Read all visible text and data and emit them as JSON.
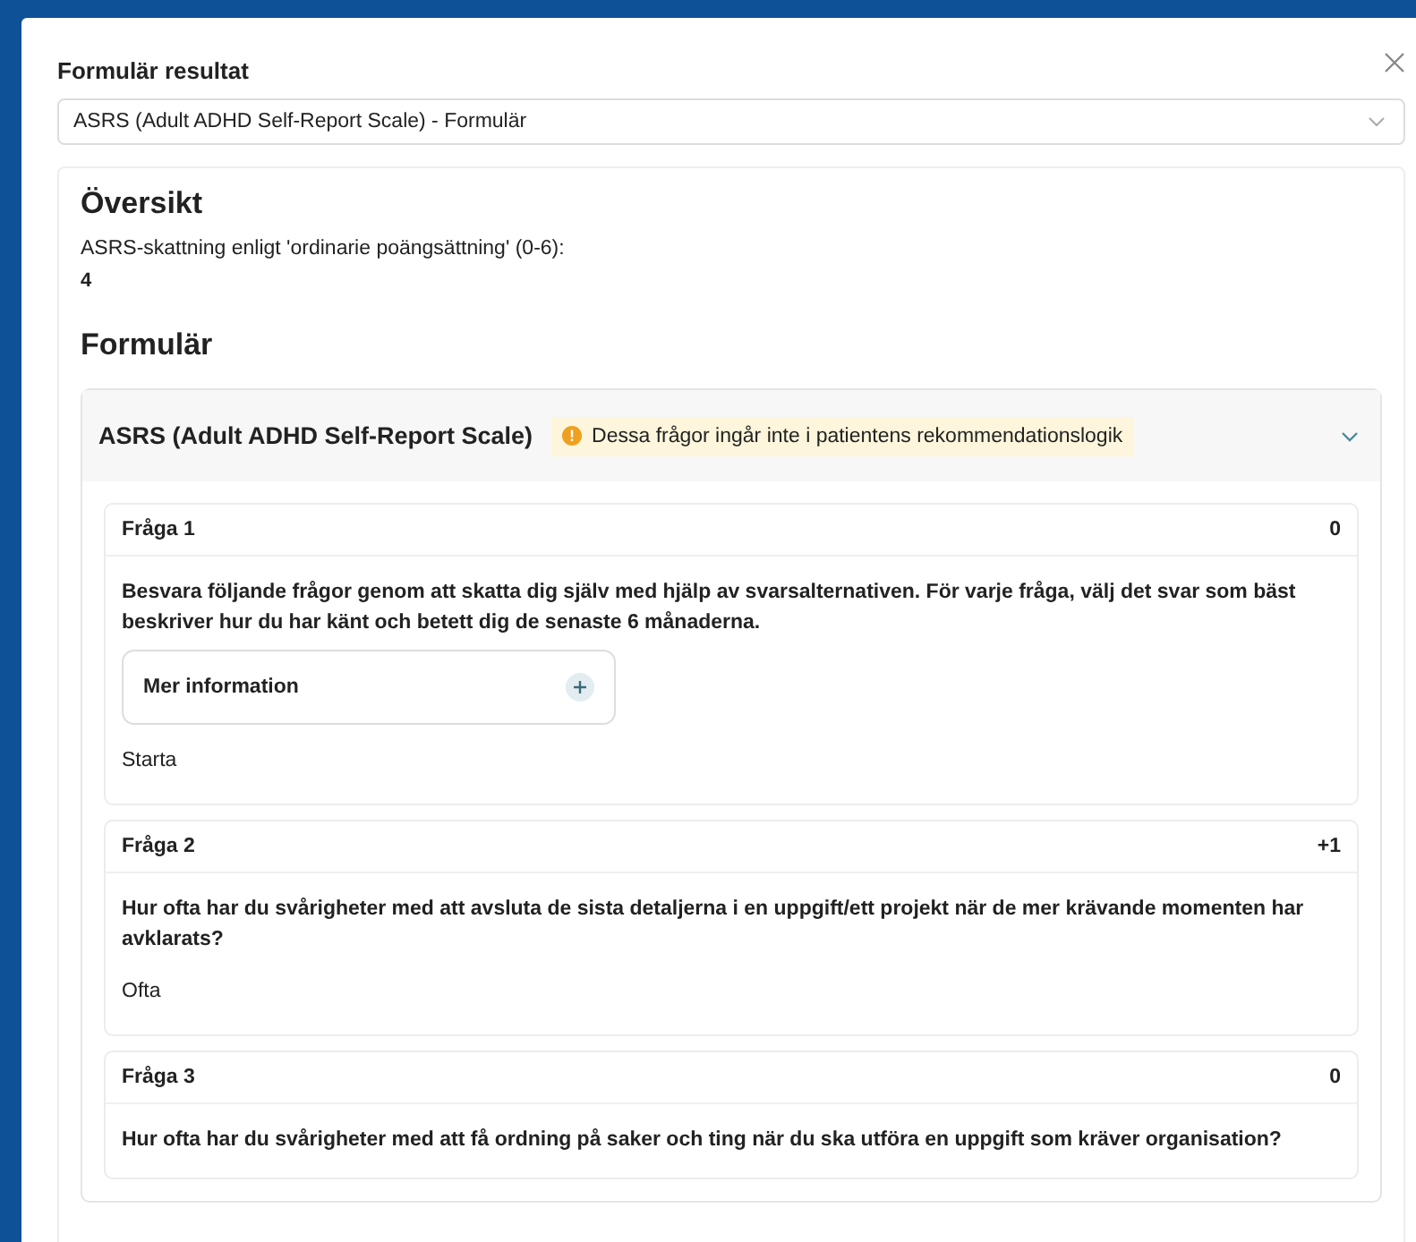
{
  "dialog": {
    "title": "Formulär resultat",
    "select": {
      "value": "ASRS (Adult ADHD Self-Report Scale) - Formulär"
    }
  },
  "overview": {
    "heading": "Översikt",
    "score_label": "ASRS-skattning enligt 'ordinarie poängsättning' (0-6):",
    "score": "4"
  },
  "form": {
    "heading": "Formulär",
    "section": {
      "title": "ASRS (Adult ADHD Self-Report Scale)",
      "notice": "Dessa frågor ingår inte i patientens rekommendationslogik",
      "expanded": true,
      "questions": [
        {
          "title": "Fråga 1",
          "points": "0",
          "text": "Besvara följande frågor genom att skatta dig själv med hjälp av svarsalternativen. För varje fråga, välj det svar som bäst beskriver hur du har känt och betett dig de senaste 6 månaderna.",
          "more": {
            "label": "Mer information",
            "expanded": false
          },
          "answer": "Starta"
        },
        {
          "title": "Fråga 2",
          "points": "+1",
          "text": "Hur ofta har du svårigheter med att avsluta de sista detaljerna i en uppgift/ett projekt när de mer krävande momenten har avklarats?",
          "answer": "Ofta"
        },
        {
          "title": "Fråga 3",
          "points": "0",
          "text": "Hur ofta har du svårigheter med att få ordning på saker och ting när du ska utföra en uppgift som kräver organisation?"
        }
      ]
    }
  }
}
